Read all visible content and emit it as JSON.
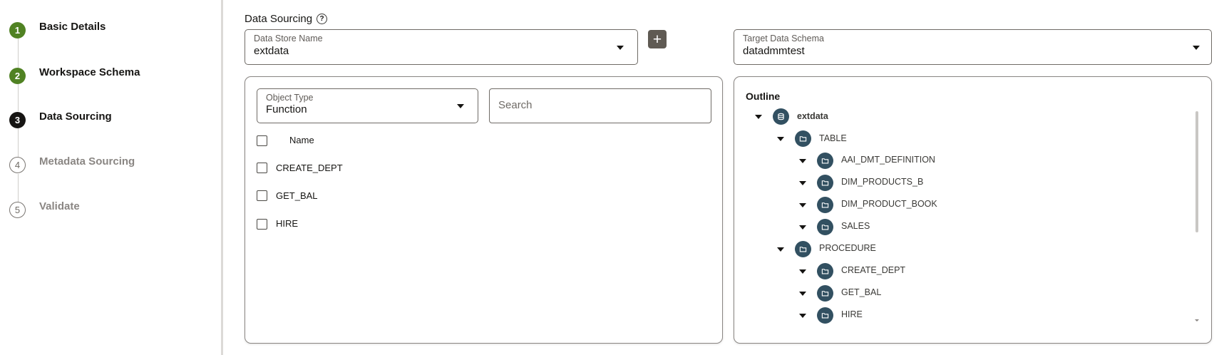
{
  "steps": [
    {
      "number": "1",
      "label": "Basic Details",
      "state": "done"
    },
    {
      "number": "2",
      "label": "Workspace Schema",
      "state": "done"
    },
    {
      "number": "3",
      "label": "Data Sourcing",
      "state": "current"
    },
    {
      "number": "4",
      "label": "Metadata Sourcing",
      "state": "todo"
    },
    {
      "number": "5",
      "label": "Validate",
      "state": "todo"
    }
  ],
  "section": {
    "title": "Data Sourcing",
    "help_glyph": "?"
  },
  "data_store": {
    "label": "Data Store Name",
    "value": "extdata"
  },
  "add_button": {
    "glyph": "+"
  },
  "target_schema": {
    "label": "Target Data Schema",
    "value": "datadmmtest"
  },
  "object_type": {
    "label": "Object Type",
    "value": "Function"
  },
  "search": {
    "placeholder": "Search"
  },
  "list": {
    "header": "Name",
    "rows": [
      "CREATE_DEPT",
      "GET_BAL",
      "HIRE"
    ]
  },
  "outline": {
    "title": "Outline",
    "nodes": [
      {
        "label": "extdata",
        "level": 0,
        "icon": "database-icon"
      },
      {
        "label": "TABLE",
        "level": 1,
        "icon": "folder-icon"
      },
      {
        "label": "AAI_DMT_DEFINITION",
        "level": 2,
        "icon": "folder-icon"
      },
      {
        "label": "DIM_PRODUCTS_B",
        "level": 2,
        "icon": "folder-icon"
      },
      {
        "label": "DIM_PRODUCT_BOOK",
        "level": 2,
        "icon": "folder-icon"
      },
      {
        "label": "SALES",
        "level": 2,
        "icon": "folder-icon"
      },
      {
        "label": "PROCEDURE",
        "level": 1,
        "icon": "folder-icon"
      },
      {
        "label": "CREATE_DEPT",
        "level": 2,
        "icon": "folder-icon"
      },
      {
        "label": "GET_BAL",
        "level": 2,
        "icon": "folder-icon"
      },
      {
        "label": "HIRE",
        "level": 2,
        "icon": "folder-icon"
      }
    ]
  },
  "colors": {
    "step_done": "#508223",
    "step_current": "#161513",
    "node_icon": "#325061",
    "add_button": "#5f5a53"
  }
}
